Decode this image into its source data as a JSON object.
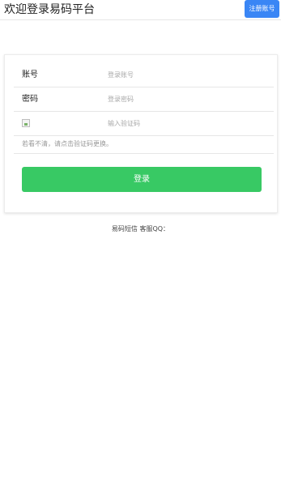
{
  "header": {
    "title": "欢迎登录易码平台",
    "register_label": "注册账号"
  },
  "form": {
    "account_label": "账号",
    "account_placeholder": "登录账号",
    "password_label": "密码",
    "password_placeholder": "登录密码",
    "captcha_placeholder": "输入验证码",
    "hint": "若看不清，请点击验证码更换。",
    "login_label": "登录"
  },
  "footer": {
    "text": "易码短信 客服QQ："
  },
  "colors": {
    "register_button": "#3a86f5",
    "login_button": "#38c964"
  }
}
